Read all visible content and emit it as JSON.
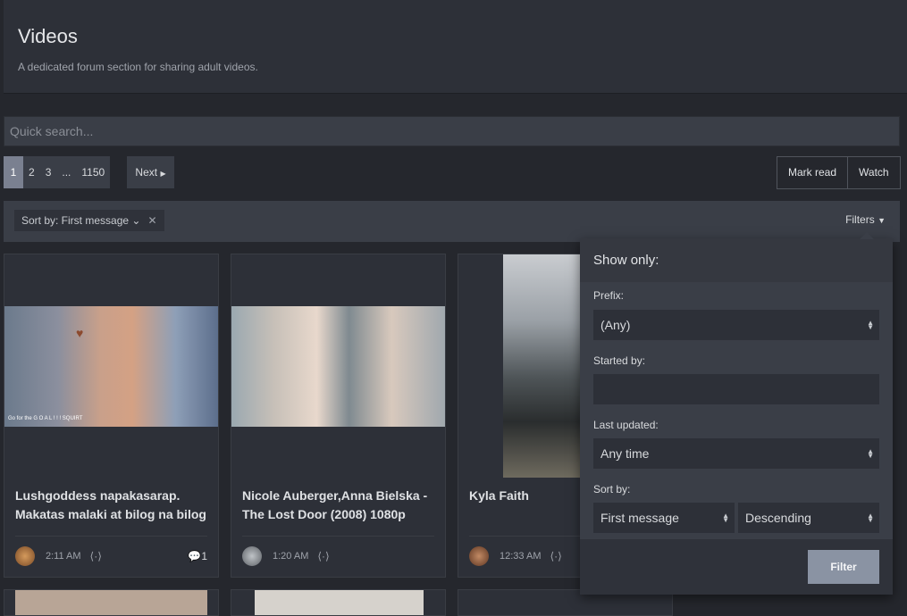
{
  "header": {
    "title": "Videos",
    "description": "A dedicated forum section for sharing adult videos."
  },
  "search": {
    "placeholder": "Quick search..."
  },
  "pagination": {
    "pages": [
      "1",
      "2",
      "3",
      "...",
      "1150"
    ],
    "current": "1",
    "next_label": "Next"
  },
  "actions": {
    "mark_read": "Mark read",
    "watch": "Watch"
  },
  "filterbar": {
    "sort_chip": "Sort by: First message",
    "filters_label": "Filters"
  },
  "cards": [
    {
      "title": "Lushgoddess napakasarap. Makatas malaki at bilog na bilog",
      "time": "2:11 AM",
      "replies": "1",
      "thumb_caption": "Go for the G O A L ! ! ! SQUIRT"
    },
    {
      "title": "Nicole Auberger,Anna Bielska - The Lost Door (2008) 1080p",
      "time": "1:20 AM",
      "replies": ""
    },
    {
      "title": "Kyla Faith",
      "time": "12:33 AM",
      "replies": ""
    }
  ],
  "filter_popup": {
    "heading": "Show only:",
    "prefix_label": "Prefix:",
    "prefix_value": "(Any)",
    "started_by_label": "Started by:",
    "started_by_value": "",
    "last_updated_label": "Last updated:",
    "last_updated_value": "Any time",
    "sort_by_label": "Sort by:",
    "sort_field_value": "First message",
    "sort_order_value": "Descending",
    "filter_button": "Filter"
  },
  "colors": {
    "background": "#25272d",
    "panel": "#2d3038",
    "control": "#3a3e47",
    "button": "#8a93a3"
  }
}
